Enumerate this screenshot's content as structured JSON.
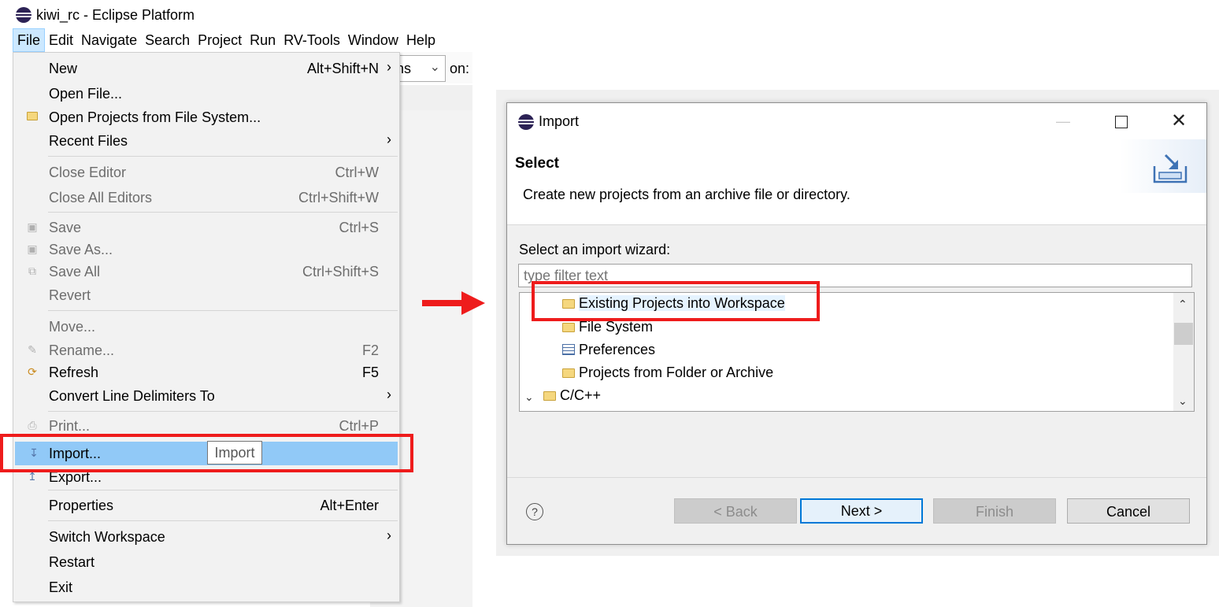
{
  "window": {
    "title": "kiwi_rc - Eclipse Platform"
  },
  "menubar": {
    "items": [
      "File",
      "Edit",
      "Navigate",
      "Search",
      "Project",
      "Run",
      "RV-Tools",
      "Window",
      "Help"
    ]
  },
  "toolbar": {
    "combo_value": "ns",
    "on_label": "on:"
  },
  "file_menu": {
    "items": [
      {
        "label": "New",
        "shortcut": "Alt+Shift+N",
        "submenu": true,
        "enabled": true
      },
      {
        "label": "Open File...",
        "shortcut": "",
        "enabled": true
      },
      {
        "label": "Open Projects from File System...",
        "shortcut": "",
        "enabled": true,
        "icon": "folder-icon"
      },
      {
        "label": "Recent Files",
        "shortcut": "",
        "submenu": true,
        "enabled": true
      },
      {
        "label": "Close Editor",
        "shortcut": "Ctrl+W",
        "enabled": false
      },
      {
        "label": "Close All Editors",
        "shortcut": "Ctrl+Shift+W",
        "enabled": false
      },
      {
        "label": "Save",
        "shortcut": "Ctrl+S",
        "enabled": false,
        "icon": "save-icon"
      },
      {
        "label": "Save As...",
        "shortcut": "",
        "enabled": false,
        "icon": "save-as-icon"
      },
      {
        "label": "Save All",
        "shortcut": "Ctrl+Shift+S",
        "enabled": false,
        "icon": "save-all-icon"
      },
      {
        "label": "Revert",
        "shortcut": "",
        "enabled": false
      },
      {
        "label": "Move...",
        "shortcut": "",
        "enabled": false
      },
      {
        "label": "Rename...",
        "shortcut": "F2",
        "enabled": false,
        "icon": "rename-icon"
      },
      {
        "label": "Refresh",
        "shortcut": "F5",
        "enabled": true,
        "icon": "refresh-icon"
      },
      {
        "label": "Convert Line Delimiters To",
        "shortcut": "",
        "submenu": true,
        "enabled": true
      },
      {
        "label": "Print...",
        "shortcut": "Ctrl+P",
        "enabled": false,
        "icon": "print-icon"
      },
      {
        "label": "Import...",
        "shortcut": "",
        "enabled": true,
        "highlighted": true,
        "icon": "import-icon"
      },
      {
        "label": "Export...",
        "shortcut": "",
        "enabled": true,
        "icon": "export-icon"
      },
      {
        "label": "Properties",
        "shortcut": "Alt+Enter",
        "enabled": true
      },
      {
        "label": "Switch Workspace",
        "shortcut": "",
        "submenu": true,
        "enabled": true
      },
      {
        "label": "Restart",
        "shortcut": "",
        "enabled": true
      },
      {
        "label": "Exit",
        "shortcut": "",
        "enabled": true
      }
    ],
    "tooltip": "Import"
  },
  "import_dialog": {
    "title": "Import",
    "heading": "Select",
    "description": "Create new projects from an archive file or directory.",
    "wizard_label": "Select an import wizard:",
    "filter_placeholder": "type filter text",
    "tree": [
      {
        "label": "Existing Projects into Workspace",
        "selected": true,
        "icon": "open-folder-icon"
      },
      {
        "label": "File System",
        "icon": "folder-icon"
      },
      {
        "label": "Preferences",
        "icon": "preferences-icon"
      },
      {
        "label": "Projects from Folder or Archive",
        "icon": "folder-icon"
      },
      {
        "label": "C/C++",
        "icon": "open-folder-icon",
        "expanded": true
      }
    ],
    "buttons": {
      "back": "< Back",
      "next": "Next >",
      "finish": "Finish",
      "cancel": "Cancel"
    },
    "help_symbol": "?"
  },
  "colors": {
    "highlight_red": "#ee1c1c",
    "menu_highlight": "#91c9f7",
    "default_button_border": "#0078d7"
  }
}
